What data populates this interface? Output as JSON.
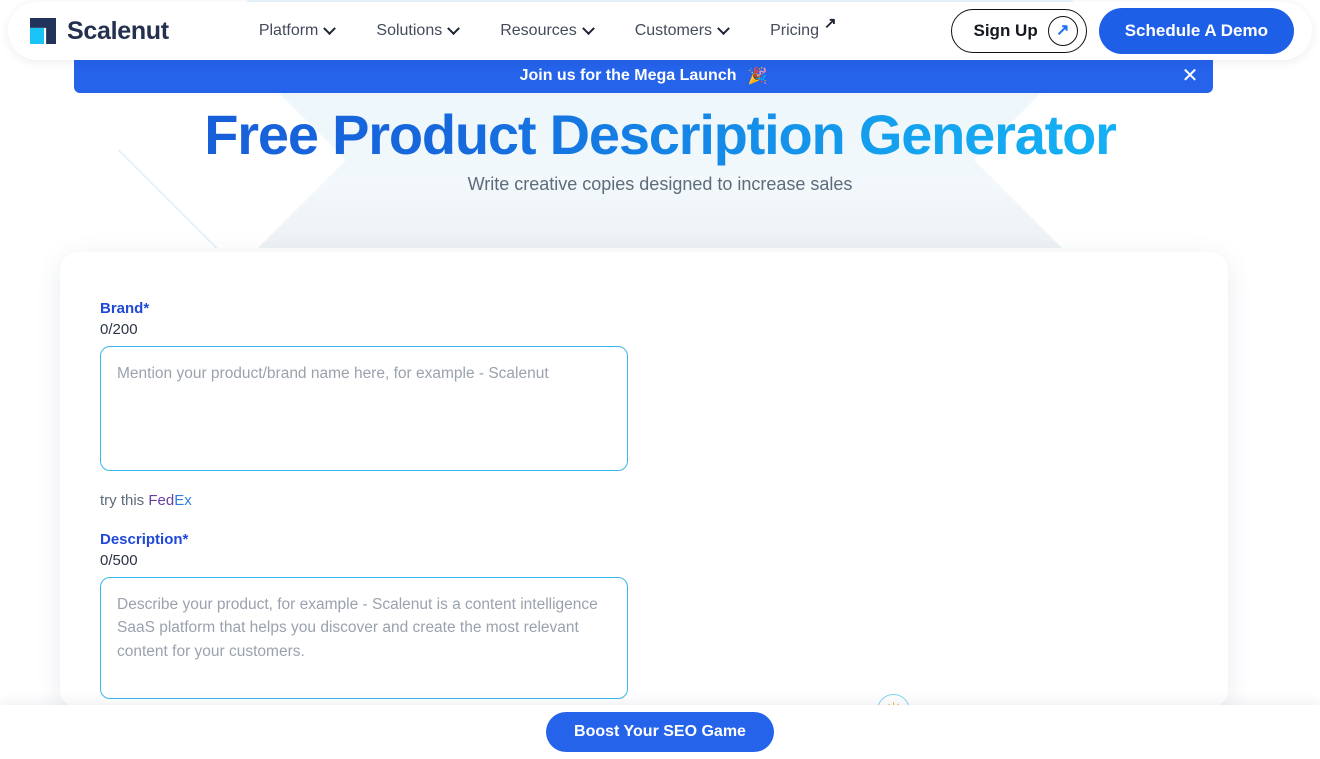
{
  "navbar": {
    "logo": {
      "text": "Scalenut",
      "icon": "scalenut-logo-icon"
    },
    "links": [
      {
        "label": "Platform",
        "icon": "chevron-down-icon"
      },
      {
        "label": "Solutions",
        "icon": "chevron-down-icon"
      },
      {
        "label": "Resources",
        "icon": "chevron-down-icon"
      },
      {
        "label": "Customers",
        "icon": "chevron-down-icon"
      },
      {
        "label": "Pricing",
        "icon": "arrow-up-right-icon"
      }
    ],
    "sign_up_label": "Sign Up",
    "sign_up_icon": "arrow-up-right-icon",
    "sign_up_arrow": "↗",
    "schedule_demo_label": "Schedule A Demo"
  },
  "banner": {
    "text": "Join us for the Mega Launch",
    "emoji": "🎉",
    "close_icon": "close-icon",
    "close_glyph": "✕",
    "color": "#2563eb"
  },
  "hero": {
    "title": "Free Product Description Generator",
    "subtitle": "Write creative copies designed to increase sales",
    "gradient_start": "#1a58d6",
    "gradient_end": "#14bef8"
  },
  "form": {
    "brand": {
      "label": "Brand*",
      "counter": "0/200",
      "value": "",
      "placeholder": "Mention your product/brand name here, for example - Scalenut"
    },
    "try_this": {
      "prefix": "try this",
      "example_part1": "Fed",
      "example_part2": "Ex"
    },
    "description": {
      "label": "Description*",
      "counter": "0/500",
      "value": "",
      "placeholder": "Describe your product, for example - Scalenut is a content intelligence SaaS platform that helps you discover and create the most relevant content for your customers."
    }
  },
  "floating_badge": {
    "icon": "sun-icon",
    "glyph": "☀"
  },
  "bottom_bar": {
    "cta_label": "Boost Your SEO Game",
    "color": "#2563eb"
  }
}
